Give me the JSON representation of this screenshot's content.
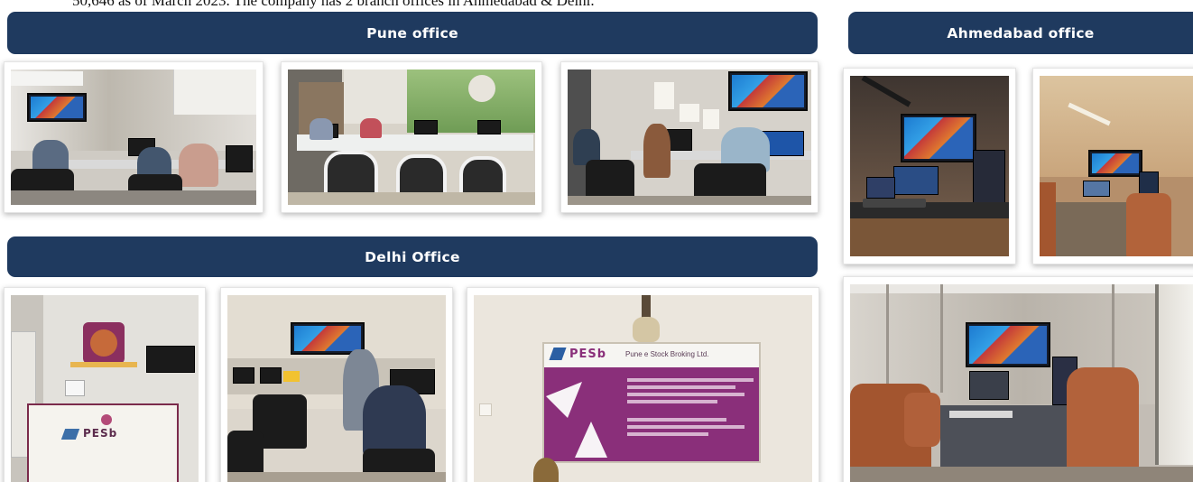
{
  "top_text": "50,646 as of March 2023. The company has 2 branch offices in Ahmedabad & Delhi.",
  "sections": {
    "pune": {
      "title": "Pune office"
    },
    "ahmedabad": {
      "title": "Ahmedabad office"
    },
    "delhi": {
      "title": "Delhi Office"
    }
  },
  "logos": {
    "delhi_reception": "PESb",
    "delhi_board": "PESb",
    "delhi_board_company": "Pune e Stock Broking Ltd."
  },
  "colors": {
    "banner": "#1f3a5f",
    "board_purple": "#8a2f7a"
  }
}
